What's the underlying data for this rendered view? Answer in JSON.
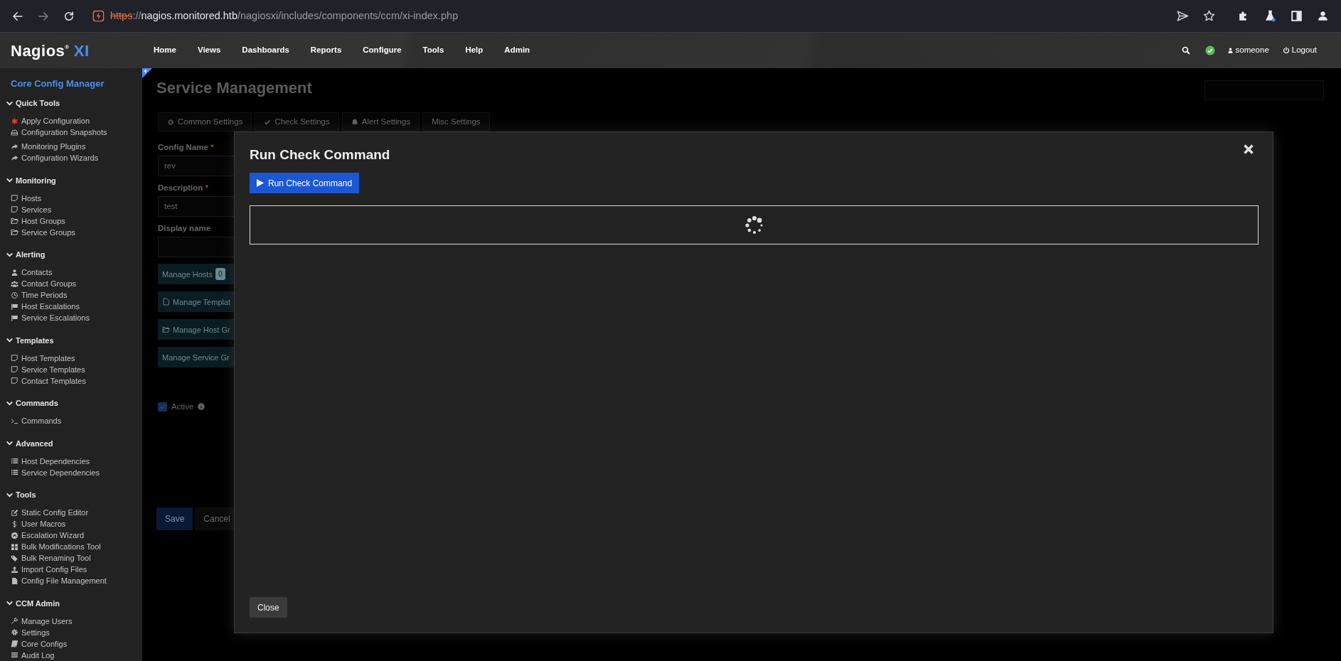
{
  "browser": {
    "url": [
      {
        "text": "https",
        "kind": "insecure"
      },
      {
        "text": "://",
        "kind": "plain"
      },
      {
        "text": "nagios.monitored.htb",
        "kind": "host"
      },
      {
        "text": "/nagiosxi/includes/components/ccm/xi-index.php",
        "kind": "plain"
      }
    ]
  },
  "navbar": {
    "logo": "Nagios$^{®}$",
    "logo_suffix": "XI",
    "menu": [
      "Home",
      "Views",
      "Dashboards",
      "Reports",
      "Configure",
      "Tools",
      "Help",
      "Admin"
    ],
    "user": "someone",
    "logout": "Logout"
  },
  "sidebar": {
    "title": "Core Config Manager",
    "sections": [
      {
        "title": "Quick Tools",
        "expanded": true,
        "groups": [
          [
            "Apply Configuration",
            "Configuration Snapshots"
          ],
          [
            "Monitoring Plugins",
            "Configuration Wizards"
          ]
        ]
      },
      {
        "title": "Monitoring",
        "expanded": true,
        "groups": [
          [
            "Hosts",
            "Services",
            "Host Groups",
            "Service Groups"
          ]
        ]
      },
      {
        "title": "Alerting",
        "expanded": true,
        "groups": [
          [
            "Contacts",
            "Contact Groups",
            "Time Periods",
            "Host Escalations",
            "Service Escalations"
          ]
        ]
      },
      {
        "title": "Templates",
        "expanded": true,
        "groups": [
          [
            "Host Templates",
            "Service Templates",
            "Contact Templates"
          ]
        ]
      },
      {
        "title": "Commands",
        "expanded": true,
        "groups": [
          [
            "Commands"
          ]
        ]
      },
      {
        "title": "Advanced",
        "expanded": true,
        "groups": [
          [
            "Host Dependencies",
            "Service Dependencies"
          ]
        ]
      },
      {
        "title": "Tools",
        "expanded": true,
        "groups": [
          [
            "Static Config Editor",
            "User Macros",
            "Escalation Wizard",
            "Bulk Modifications Tool",
            "Bulk Renaming Tool",
            "Import Config Files",
            "Config File Management"
          ]
        ]
      },
      {
        "title": "CCM Admin",
        "expanded": true,
        "groups": [
          [
            "Manage Users",
            "Settings",
            "Core Configs",
            "Audit Log"
          ]
        ]
      }
    ]
  },
  "page": {
    "title": "Service Management",
    "tabs": [
      {
        "label": "Common Settings"
      },
      {
        "label": "Check Settings"
      },
      {
        "label": "Alert Settings"
      },
      {
        "label": "Misc Settings"
      }
    ],
    "fields": [
      {
        "label": "Config Name",
        "mark": "*",
        "value": "rev"
      },
      {
        "label": "Description",
        "mark": "*",
        "value": "test"
      },
      {
        "label": "Display name"
      }
    ],
    "manage_buttons": [
      {
        "label": "Manage Hosts",
        "count": "0"
      },
      {
        "label": "Manage Templat"
      },
      {
        "label": "Manage Host Gr"
      },
      {
        "label": "Manage Service Gr"
      }
    ],
    "active": {
      "label": "Active",
      "checked": true
    },
    "actions": [
      "Save",
      "Cancel"
    ]
  },
  "modal": {
    "title": "Run Check Command",
    "run_button": "Run Check Command",
    "loading": true,
    "close_button": "Close"
  }
}
